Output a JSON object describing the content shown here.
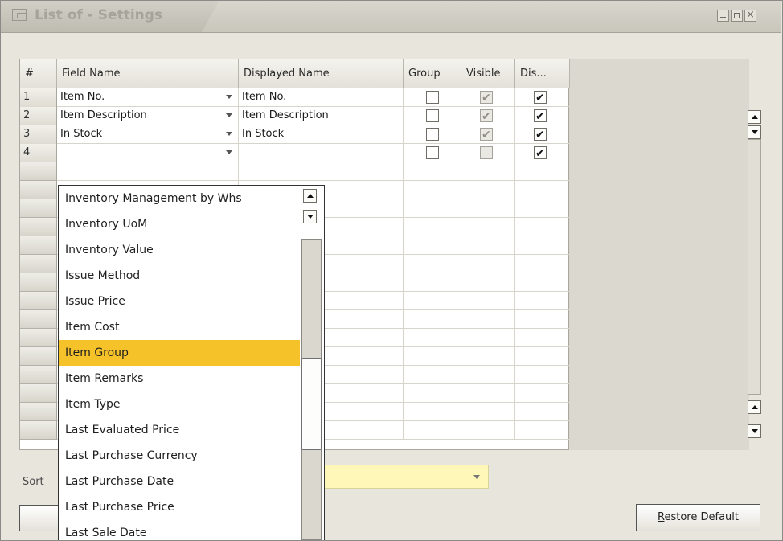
{
  "window": {
    "title": "List of - Settings",
    "controls": [
      "minimize",
      "maximize",
      "close"
    ]
  },
  "grid": {
    "columns": [
      "#",
      "Field Name",
      "Displayed Name",
      "Group",
      "Visible",
      "Dis..."
    ],
    "rows": [
      {
        "num": "1",
        "field_name": "Item No.",
        "displayed_name": "Item No.",
        "group": false,
        "visible": true,
        "visible_disabled": true,
        "display": true
      },
      {
        "num": "2",
        "field_name": "Item Description",
        "displayed_name": "Item Description",
        "group": false,
        "visible": true,
        "visible_disabled": true,
        "display": true
      },
      {
        "num": "3",
        "field_name": "In Stock",
        "displayed_name": "In Stock",
        "group": false,
        "visible": true,
        "visible_disabled": true,
        "display": true
      },
      {
        "num": "4",
        "field_name": "",
        "displayed_name": "",
        "group": false,
        "visible": false,
        "visible_disabled": true,
        "display": true
      }
    ]
  },
  "dropdown": {
    "items": [
      "Inventory Management by Whs",
      "Inventory UoM",
      "Inventory Value",
      "Issue Method",
      "Issue Price",
      "Item Cost",
      "Item Group",
      "Item Remarks",
      "Item Type",
      "Last Evaluated Price",
      "Last Purchase Currency",
      "Last Purchase Date",
      "Last Purchase Price",
      "Last Sale Date"
    ],
    "selected": "Item Group"
  },
  "footer": {
    "sort_label": "Sort",
    "restore_default_underline": "R",
    "restore_default_rest": "estore Default"
  },
  "colors": {
    "selection": "#f5c22a",
    "sort_field": "#fff7b7"
  }
}
